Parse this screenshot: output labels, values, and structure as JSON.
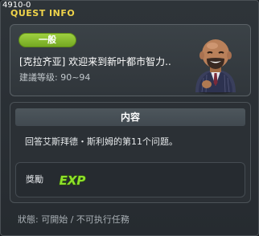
{
  "window": {
    "quest_id": "4910-0",
    "title": "QUEST INFO"
  },
  "header": {
    "category": "一般",
    "quest_name": "[克拉齐亚] 欢迎来到新叶都市智力..",
    "level_info": "建議等级: 90~94"
  },
  "npc": {
    "icon": "npc-portrait-bald-man-in-suit"
  },
  "content": {
    "header_label": "内容",
    "description": "回答艾斯拜德・斯利姆的第11个问题。"
  },
  "reward": {
    "label": "獎勵",
    "exp_text": "EXP"
  },
  "status": {
    "text": "狀態: 可開始 / 不可执行任務"
  },
  "colors": {
    "title": "#f0d44a",
    "category_badge": "#8cc232",
    "exp": "#8ee02a"
  }
}
